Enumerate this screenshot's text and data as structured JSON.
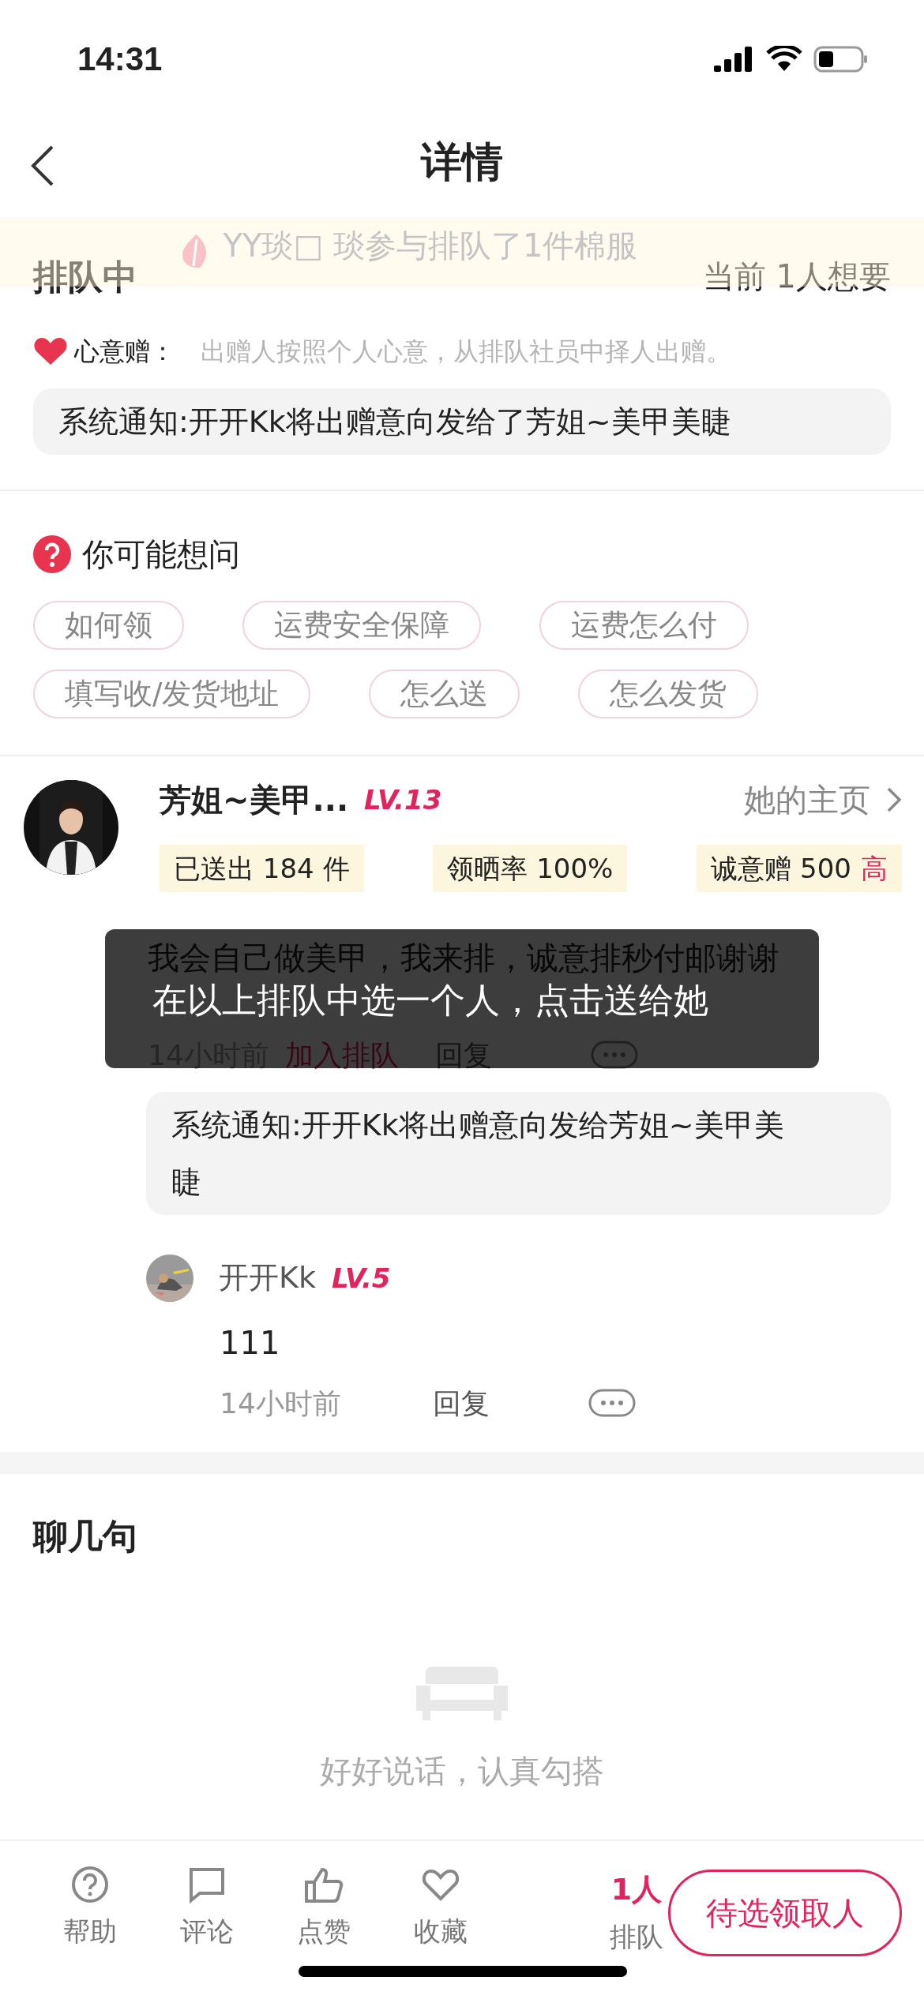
{
  "status_bar": {
    "time": "14:31"
  },
  "nav": {
    "title": "详情"
  },
  "banner": {
    "text": "YY琰□ 琰参与排队了1件棉服"
  },
  "queue": {
    "title": "排队中",
    "count": "当前 1人想要",
    "mode_label": "心意赠：",
    "mode_desc": "出赠人按照个人心意，从排队社员中择人出赠。",
    "notice": "系统通知:开开Kk将出赠意向发给了芳姐~美甲美睫"
  },
  "faq": {
    "title": "你可能想问",
    "chips": [
      "如何领",
      "运费安全保障",
      "运费怎么付",
      "填写收/发货地址",
      "怎么送",
      "怎么发货"
    ]
  },
  "giver": {
    "name": "芳姐~美甲...",
    "level": "LV.13",
    "home_link": "她的主页",
    "stats": [
      {
        "text": "已送出 184 件"
      },
      {
        "text": "领晒率 100%"
      },
      {
        "text": "诚意赠 500",
        "highlight": "高"
      }
    ]
  },
  "comment": {
    "text": "我会自己做美甲，我来排，诚意排秒付邮谢谢",
    "time": "14小时前",
    "join": "加入排队",
    "reply": "回复",
    "notice": "系统通知:开开Kk将出赠意向发给芳姐~美甲美睫",
    "replies": [
      {
        "name": "开开Kk",
        "level": "LV.5",
        "text": "111",
        "time": "14小时前",
        "reply": "回复"
      }
    ]
  },
  "toast": {
    "text": "在以上排队中选一个人，点击送给她"
  },
  "chat": {
    "title": "聊几句",
    "empty": "好好说话，认真勾搭"
  },
  "tab_bar": {
    "items": [
      {
        "kind": "help",
        "label": "帮助"
      },
      {
        "kind": "comment",
        "label": "评论"
      },
      {
        "kind": "like",
        "label": "点赞"
      },
      {
        "kind": "favorite",
        "label": "收藏"
      }
    ],
    "queue": {
      "count": "1人",
      "label": "排队"
    },
    "action": "待选领取人"
  }
}
